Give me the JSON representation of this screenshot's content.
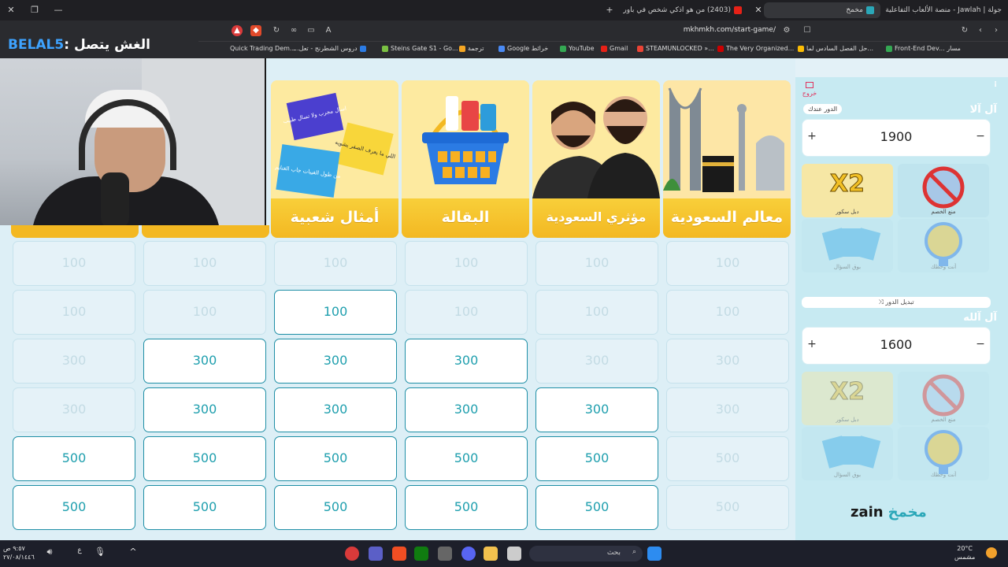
{
  "browser": {
    "tabs": [
      {
        "label": "جولة | Jawlah - منصة الألعاب التفاعلية",
        "active": false
      },
      {
        "label": "مخمخ",
        "active": true
      },
      {
        "label": "(2403) من هو اذكي شخص في باور",
        "active": false
      }
    ],
    "url": "mkhmkh.com/start-game/",
    "bookmarks": [
      "Quick Trading Dem...",
      "دروس الشطرنج - تعل...",
      "Steins Gate S1 - Go...",
      "ترجمة",
      "Google خرائط",
      "YouTube",
      "Gmail",
      "STEAMUNLOCKED »...",
      "The Very Organized...",
      "حل الفصل السادس لما...",
      "Front-End Dev... مسار"
    ]
  },
  "overlay": {
    "prefix": "الغش يتصل : ",
    "name": "BELAL5"
  },
  "categories": [
    {
      "label": "أمثال شعبية",
      "notes": [
        "اسال مجرب ولا تسال طبيب",
        "من طول الغيبات جاب الغنايم",
        "اللي ما يعرف الصقر يشويه"
      ]
    },
    {
      "label": "البقالة"
    },
    {
      "label": "مؤثري السعودية"
    },
    {
      "label": "معالم السعودية"
    }
  ],
  "grid": {
    "columns": 6,
    "rows": [
      [
        {
          "v": "100",
          "used": true
        },
        {
          "v": "100",
          "used": true
        },
        {
          "v": "100",
          "used": true
        },
        {
          "v": "100",
          "used": true
        },
        {
          "v": "100",
          "used": true
        },
        {
          "v": "100",
          "used": true
        }
      ],
      [
        {
          "v": "100",
          "used": true
        },
        {
          "v": "100",
          "used": true
        },
        {
          "v": "100",
          "used": false
        },
        {
          "v": "100",
          "used": true
        },
        {
          "v": "100",
          "used": true
        },
        {
          "v": "100",
          "used": true
        }
      ],
      [
        {
          "v": "300",
          "used": true
        },
        {
          "v": "300",
          "used": false
        },
        {
          "v": "300",
          "used": false
        },
        {
          "v": "300",
          "used": false
        },
        {
          "v": "300",
          "used": true
        },
        {
          "v": "300",
          "used": true
        }
      ],
      [
        {
          "v": "300",
          "used": true
        },
        {
          "v": "300",
          "used": false
        },
        {
          "v": "300",
          "used": false
        },
        {
          "v": "300",
          "used": false
        },
        {
          "v": "300",
          "used": false
        },
        {
          "v": "300",
          "used": true
        }
      ],
      [
        {
          "v": "500",
          "used": false
        },
        {
          "v": "500",
          "used": false
        },
        {
          "v": "500",
          "used": false
        },
        {
          "v": "500",
          "used": false
        },
        {
          "v": "500",
          "used": false
        },
        {
          "v": "500",
          "used": true
        }
      ],
      [
        {
          "v": "500",
          "used": false
        },
        {
          "v": "500",
          "used": false
        },
        {
          "v": "500",
          "used": false
        },
        {
          "v": "500",
          "used": false
        },
        {
          "v": "500",
          "used": false
        },
        {
          "v": "500",
          "used": true
        }
      ]
    ]
  },
  "panel": {
    "exit_label": "خروج",
    "team1": {
      "name": "آل آلا",
      "turn_badge": "الدور عندك",
      "score": "1900"
    },
    "team2": {
      "name": "آل آلله",
      "score": "1600"
    },
    "swap_label": "تبديل الدور",
    "powers": [
      {
        "key": "double",
        "text": "X2",
        "caption": "دبل سكور"
      },
      {
        "key": "block",
        "caption": "منع الخصم"
      },
      {
        "key": "steal",
        "caption": "بوق السؤال"
      },
      {
        "key": "luck",
        "caption": "أنت وحظك"
      }
    ],
    "brand": {
      "left": "zain",
      "right": "مخمخ"
    }
  },
  "taskbar": {
    "search_placeholder": "بحث",
    "weather": "20°C",
    "weather_sub": "مشمس",
    "time": "٩:٥٧ ص",
    "date": "٢٧/٠٨/١٤٤٦",
    "lang": "ع"
  },
  "colors": {
    "accent": "#1f9fae",
    "category_yellow": "#f3b822",
    "panel_bg": "#c7eaf2",
    "board_bg": "#ddeff6"
  }
}
